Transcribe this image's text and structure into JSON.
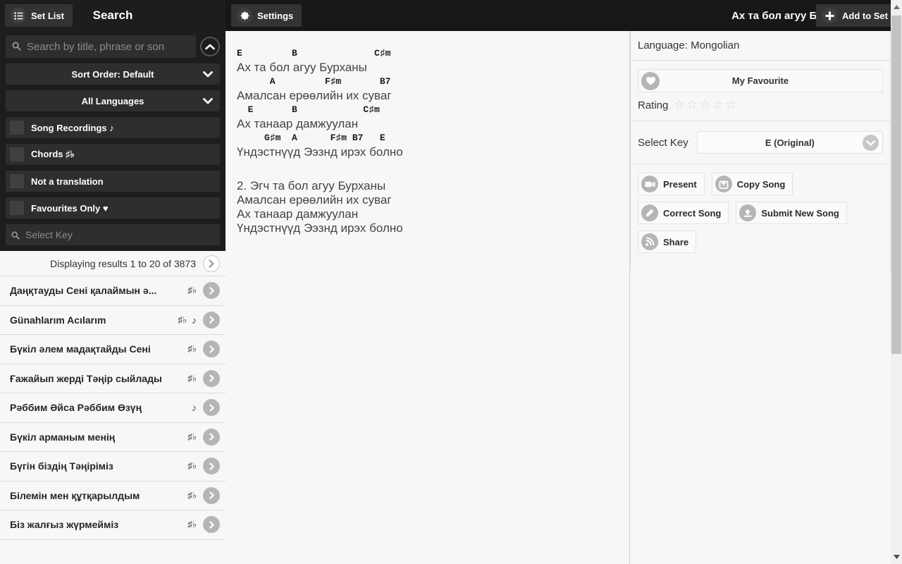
{
  "topbar": {
    "set_list_label": "Set List",
    "search_title": "Search",
    "settings_label": "Settings",
    "song_title": "Ах та бол агуу Бурхан",
    "add_to_set_label": "Add to Set"
  },
  "sidebar": {
    "search": {
      "placeholder": "Search by title, phrase or son",
      "value": ""
    },
    "sort_order_label": "Sort Order: Default",
    "languages_label": "All Languages",
    "filters": [
      {
        "label": "Song Recordings",
        "suffix": "♪",
        "checked": false
      },
      {
        "label": "Chords",
        "suffix": "♯♭",
        "checked": false
      },
      {
        "label": "Not a translation",
        "suffix": "",
        "checked": false
      },
      {
        "label": "Favourites Only",
        "suffix": "♥",
        "checked": false
      }
    ],
    "select_key": {
      "placeholder": "Select Key",
      "value": ""
    },
    "results_header": "Displaying results 1 to 20 of 3873",
    "results": [
      {
        "title": "Даңқтауды Сені қалаймын ә...",
        "chords": "♯♭",
        "recording": ""
      },
      {
        "title": "Günahlarım Acılarım",
        "chords": "♯♭",
        "recording": "♪"
      },
      {
        "title": "Бүкіл әлем мадақтайды Сені",
        "chords": "♯♭",
        "recording": ""
      },
      {
        "title": "Ғажайып жерді Тәңір сыйлады",
        "chords": "♯♭",
        "recording": ""
      },
      {
        "title": "Рәббим Әйса Рәббим Өзүң",
        "chords": "",
        "recording": "♪"
      },
      {
        "title": "Бүкіл арманым менің",
        "chords": "♯♭",
        "recording": ""
      },
      {
        "title": "Бүгін біздің Тәңіріміз",
        "chords": "♯♭",
        "recording": ""
      },
      {
        "title": "Білемін мен құтқарылдым",
        "chords": "♯♭",
        "recording": ""
      },
      {
        "title": "Біз жалғыз жүрмейміз",
        "chords": "♯♭",
        "recording": ""
      }
    ]
  },
  "lyrics": {
    "verse1": [
      {
        "chords": "E         B              C♯m",
        "text": "Ах та бол агуу Бурханы"
      },
      {
        "chords": "      A         F♯m       B7",
        "text": "Амалсан ерөөлийн их суваг"
      },
      {
        "chords": "  E       B            C♯m",
        "text": "Ах танаар дамжуулан"
      },
      {
        "chords": "     G♯m  A      F♯m B7   E",
        "text": "Үндэстнүүд Ээзнд ирэх болно"
      }
    ],
    "verse2": [
      "2. Эгч та бол агуу Бурханы",
      "Амалсан ерөөлийн их суваг",
      "Ах танаар дамжуулан",
      "Үндэстнүүд Ээзнд ирэх болно"
    ]
  },
  "details": {
    "language": "Language: Mongolian",
    "favourite_label": "My Favourite",
    "rating_label": "Rating",
    "rating_value": 0,
    "rating_max": 5,
    "select_key_label": "Select Key",
    "selected_key": "E (Original)",
    "actions": [
      {
        "label": "Present",
        "icon": "video-camera-icon"
      },
      {
        "label": "Copy Song",
        "icon": "copy-icon"
      },
      {
        "label": "Correct Song",
        "icon": "pencil-icon"
      },
      {
        "label": "Submit New Song",
        "icon": "upload-icon"
      },
      {
        "label": "Share",
        "icon": "rss-icon"
      }
    ]
  }
}
